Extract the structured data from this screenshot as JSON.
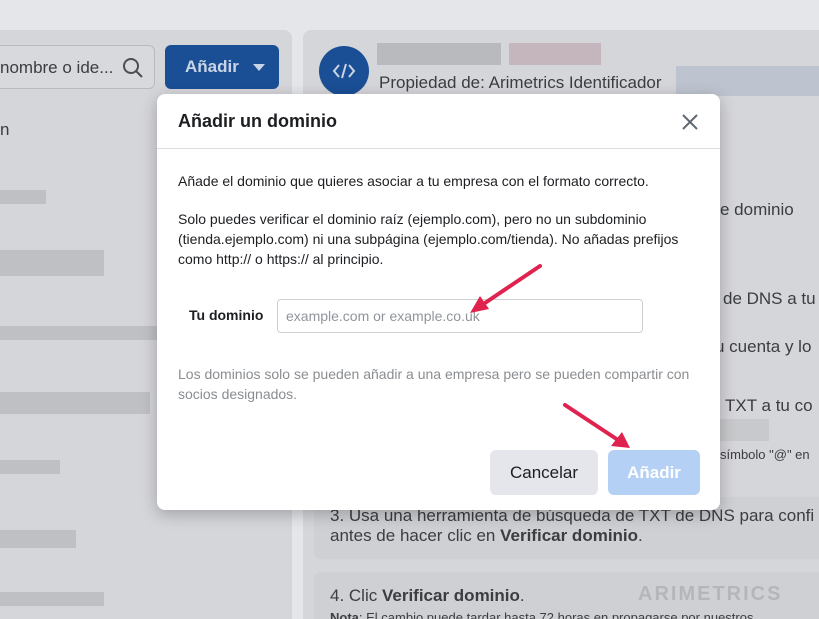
{
  "background": {
    "search": {
      "text": "nombre o ide..."
    },
    "add_button": {
      "label": "Añadir"
    },
    "left_fragment": "n",
    "property_line": "Propiedad de: Arimetrics  Identificador",
    "fragments": {
      "domain_tab": "e dominio",
      "dns_line": "de DNS a tu",
      "account_line": "u cuenta y lo",
      "txt_line": "TXT a tu co",
      "symbol_line": "símbolo \"@\" en"
    },
    "step3": {
      "line1": "3. Usa una herramienta de búsqueda de TXT de DNS para confi",
      "line2_prefix": "antes de hacer clic en ",
      "line2_bold": "Verificar dominio",
      "line2_suffix": "."
    },
    "step4": {
      "prefix": "4. Clic ",
      "bold": "Verificar dominio",
      "suffix": ".",
      "note_bold": "Nota",
      "note_text": ": El cambio puede tardar hasta 72 horas en propagarse por nuestros"
    },
    "watermark": "ARIMETRICS"
  },
  "modal": {
    "title": "Añadir un dominio",
    "intro": "Añade el dominio que quieres asociar a tu empresa con el formato correcto.",
    "instructions": "Solo puedes verificar el dominio raíz (ejemplo.com), pero no un subdominio (tienda.ejemplo.com) ni una subpágina (ejemplo.com/tienda). No añadas prefijos como http:// o https:// al principio.",
    "field_label": "Tu dominio",
    "field_placeholder": "example.com or example.co.uk",
    "field_value": "",
    "note": "Los dominios solo se pueden añadir a una empresa pero se pueden compartir con socios designados.",
    "cancel_label": "Cancelar",
    "submit_label": "Añadir"
  },
  "colors": {
    "primary": "#1a4f95",
    "submit_disabled": "#b4d0f5",
    "annotation_arrow": "#e0234e"
  },
  "icons": {
    "search": "search-icon",
    "code": "code-icon",
    "close": "close-icon",
    "caret": "caret-down-icon"
  }
}
